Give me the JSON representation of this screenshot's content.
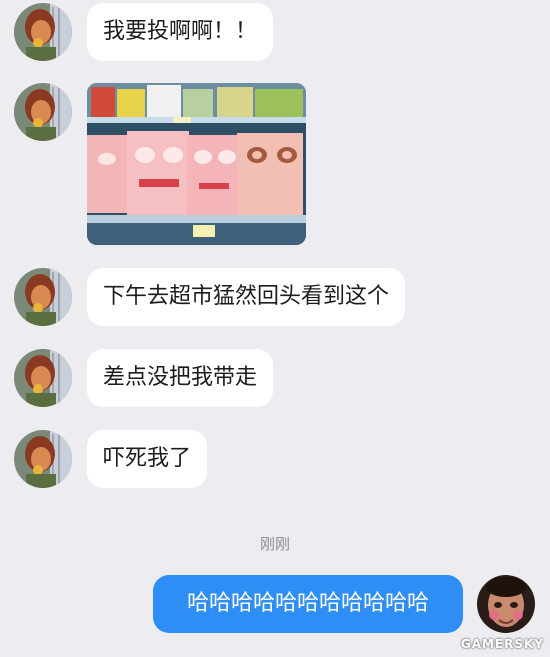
{
  "chat": {
    "messages": [
      {
        "sender": "other",
        "type": "text",
        "text": "我要投啊啊！！"
      },
      {
        "sender": "other",
        "type": "image",
        "description": "supermarket shelf with face-mask packaging"
      },
      {
        "sender": "other",
        "type": "text",
        "text": "下午去超市猛然回头看到这个"
      },
      {
        "sender": "other",
        "type": "text",
        "text": "差点没把我带走"
      },
      {
        "sender": "other",
        "type": "text",
        "text": "吓死我了"
      },
      {
        "sender": "self",
        "type": "text",
        "text": "哈哈哈哈哈哈哈哈哈哈哈"
      }
    ],
    "timestamp": "刚刚"
  },
  "watermark": "GAMERSKY",
  "colors": {
    "background": "#ececf1",
    "incoming_bubble": "#ffffff",
    "outgoing_bubble": "#2e8ef6",
    "timestamp": "#8e8e93"
  },
  "icons": {
    "other_avatar": "avatar-icon",
    "self_avatar": "avatar-icon"
  }
}
